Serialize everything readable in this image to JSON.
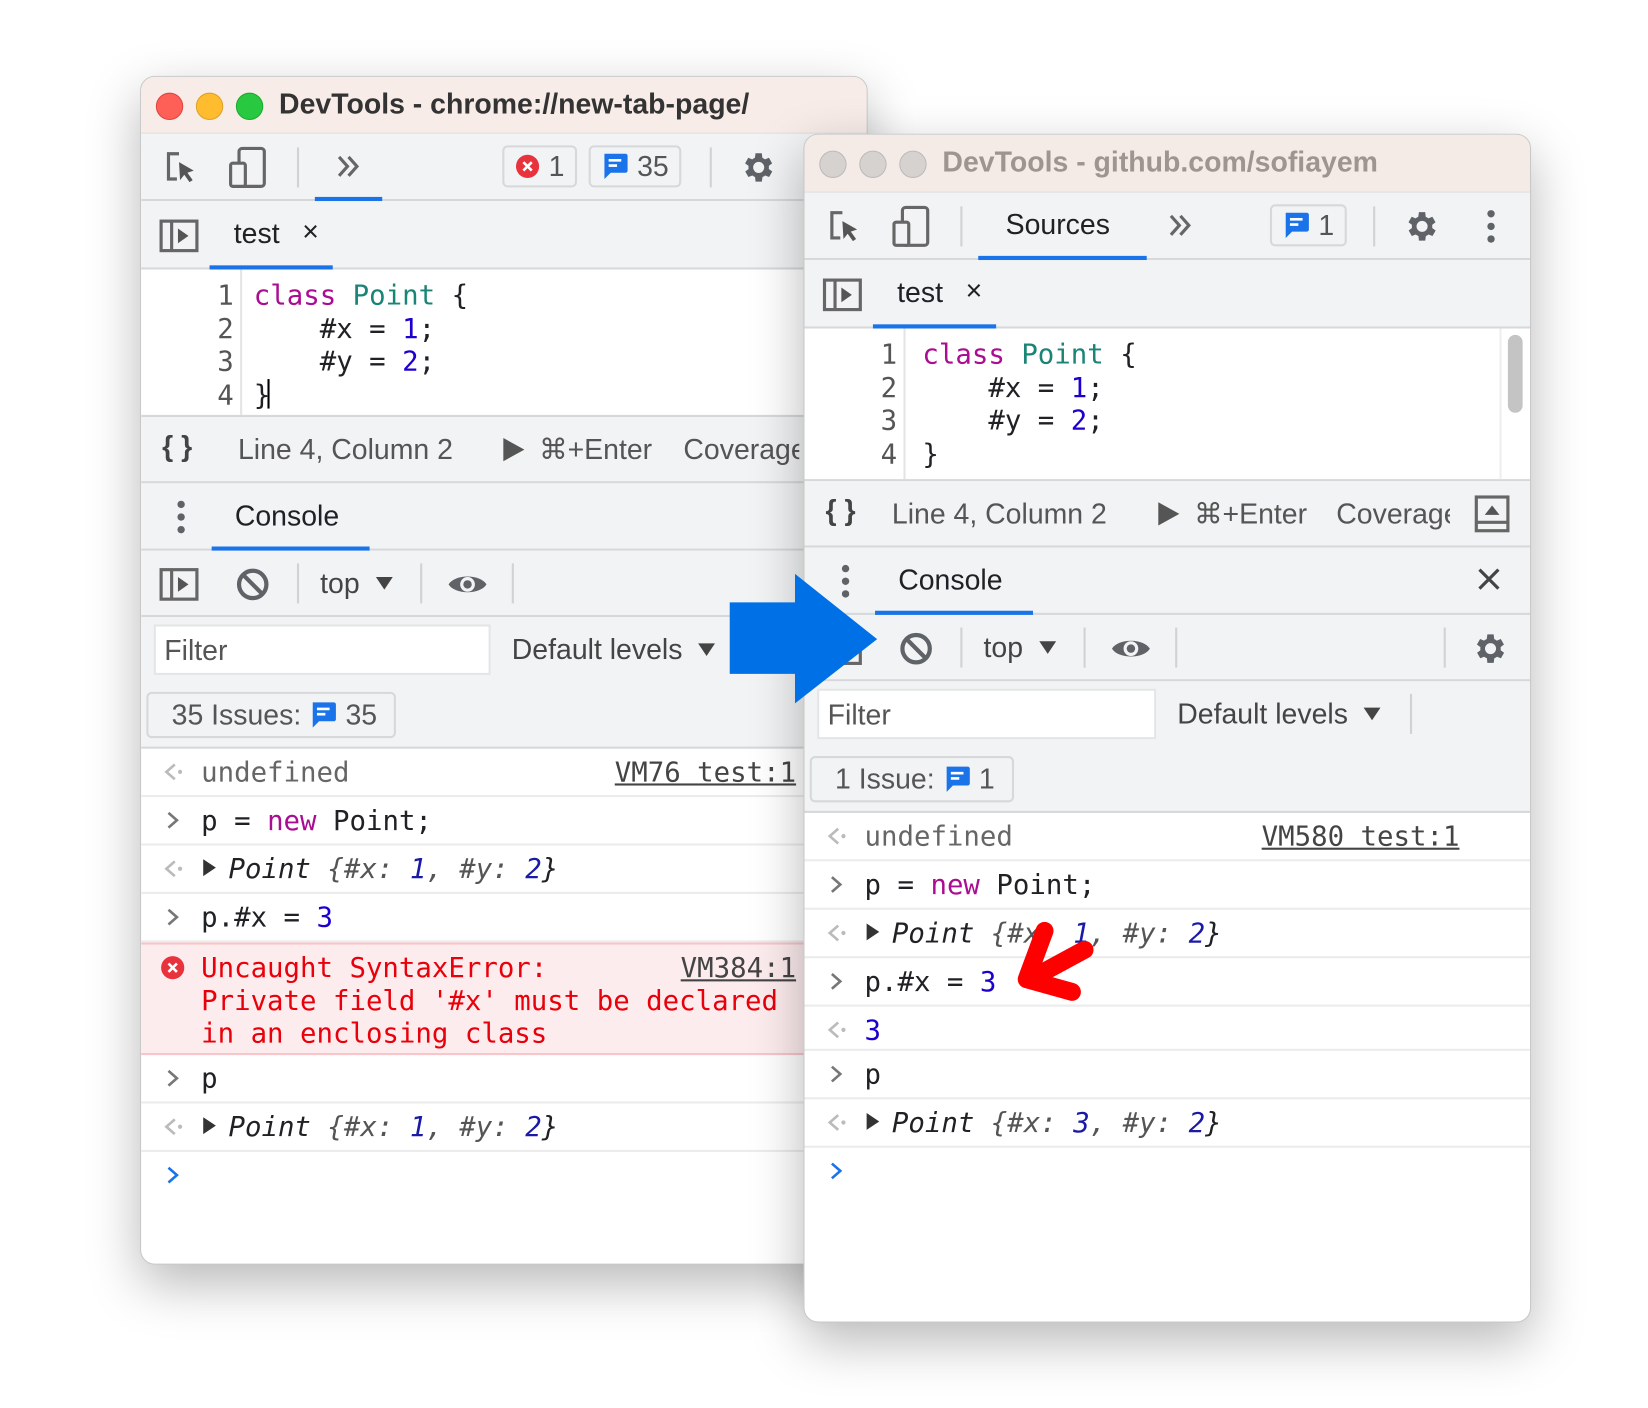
{
  "colors": {
    "accent": "#1a73e8",
    "error": "#e8000a",
    "annotation_blue": "#0070e6",
    "annotation_red": "#ff0000"
  },
  "left": {
    "title": "DevTools - chrome://new-tab-page/",
    "toolbar": {
      "more_tabs": "»",
      "error_count": "1",
      "issue_count": "35"
    },
    "editor_tab": {
      "label": "test",
      "close": "×"
    },
    "code": [
      {
        "n": "1",
        "tokens": [
          {
            "t": "class ",
            "c": "kw"
          },
          {
            "t": "Point ",
            "c": "cls"
          },
          {
            "t": "{",
            "c": "plain"
          }
        ]
      },
      {
        "n": "2",
        "tokens": [
          {
            "t": "    #x = ",
            "c": "plain"
          },
          {
            "t": "1",
            "c": "num"
          },
          {
            "t": ";",
            "c": "plain"
          }
        ]
      },
      {
        "n": "3",
        "tokens": [
          {
            "t": "    #y = ",
            "c": "plain"
          },
          {
            "t": "2",
            "c": "num"
          },
          {
            "t": ";",
            "c": "plain"
          }
        ]
      },
      {
        "n": "4",
        "tokens": [
          {
            "t": "}",
            "c": "plain"
          }
        ]
      }
    ],
    "status": {
      "format": "{ }",
      "position": "Line 4, Column 2",
      "run": "⌘+Enter",
      "coverage": "Coverage"
    },
    "drawer": {
      "tab": "Console"
    },
    "console_toolbar": {
      "context": "top"
    },
    "filter": {
      "placeholder": "Filter",
      "levels": "Default levels"
    },
    "issues": {
      "label": "35 Issues:",
      "count": "35"
    },
    "messages": [
      {
        "kind": "output",
        "tokens": [
          {
            "t": "undefined",
            "c": "gray"
          }
        ],
        "link": "VM76 test:1"
      },
      {
        "kind": "input",
        "tokens": [
          {
            "t": "p = ",
            "c": "plain"
          },
          {
            "t": "new",
            "c": "kw"
          },
          {
            "t": " Point;",
            "c": "plain"
          }
        ]
      },
      {
        "kind": "output",
        "expand": true,
        "tokens": [
          {
            "t": "Point ",
            "c": "obj"
          },
          {
            "t": "{#x: ",
            "c": "objkey"
          },
          {
            "t": "1",
            "c": "objnum"
          },
          {
            "t": ", #y: ",
            "c": "objkey"
          },
          {
            "t": "2",
            "c": "objnum"
          },
          {
            "t": "}",
            "c": "obj"
          }
        ]
      },
      {
        "kind": "input",
        "tokens": [
          {
            "t": "p.#x = ",
            "c": "plain"
          },
          {
            "t": "3",
            "c": "num"
          }
        ]
      },
      {
        "kind": "error",
        "tokens": [
          {
            "t": "Uncaught SyntaxError:\nPrivate field '#x' must be declared\nin an enclosing class",
            "c": "err"
          }
        ],
        "link": "VM384:1"
      },
      {
        "kind": "input",
        "tokens": [
          {
            "t": "p",
            "c": "plain"
          }
        ]
      },
      {
        "kind": "output",
        "expand": true,
        "tokens": [
          {
            "t": "Point ",
            "c": "obj"
          },
          {
            "t": "{#x: ",
            "c": "objkey"
          },
          {
            "t": "1",
            "c": "objnum"
          },
          {
            "t": ", #y: ",
            "c": "objkey"
          },
          {
            "t": "2",
            "c": "objnum"
          },
          {
            "t": "}",
            "c": "obj"
          }
        ]
      },
      {
        "kind": "prompt",
        "tokens": []
      }
    ]
  },
  "right": {
    "title": "DevTools - github.com/sofiayem",
    "toolbar": {
      "active_tab": "Sources",
      "more_tabs": "»",
      "issue_count": "1"
    },
    "editor_tab": {
      "label": "test",
      "close": "×"
    },
    "code": [
      {
        "n": "1",
        "tokens": [
          {
            "t": "class ",
            "c": "kw"
          },
          {
            "t": "Point ",
            "c": "cls"
          },
          {
            "t": "{",
            "c": "plain"
          }
        ]
      },
      {
        "n": "2",
        "tokens": [
          {
            "t": "    #x = ",
            "c": "plain"
          },
          {
            "t": "1",
            "c": "num"
          },
          {
            "t": ";",
            "c": "plain"
          }
        ]
      },
      {
        "n": "3",
        "tokens": [
          {
            "t": "    #y = ",
            "c": "plain"
          },
          {
            "t": "2",
            "c": "num"
          },
          {
            "t": ";",
            "c": "plain"
          }
        ]
      },
      {
        "n": "4",
        "tokens": [
          {
            "t": "}",
            "c": "plain"
          }
        ]
      }
    ],
    "status": {
      "format": "{ }",
      "position": "Line 4, Column 2",
      "run": "⌘+Enter",
      "coverage": "Coverage"
    },
    "drawer": {
      "tab": "Console",
      "close": "✕"
    },
    "console_toolbar": {
      "context": "top"
    },
    "filter": {
      "placeholder": "Filter",
      "levels": "Default levels"
    },
    "issues": {
      "label": "1 Issue:",
      "count": "1"
    },
    "messages": [
      {
        "kind": "output",
        "tokens": [
          {
            "t": "undefined",
            "c": "gray"
          }
        ],
        "link": "VM580 test:1"
      },
      {
        "kind": "input",
        "tokens": [
          {
            "t": "p = ",
            "c": "plain"
          },
          {
            "t": "new",
            "c": "kw"
          },
          {
            "t": " Point;",
            "c": "plain"
          }
        ]
      },
      {
        "kind": "output",
        "expand": true,
        "tokens": [
          {
            "t": "Point ",
            "c": "obj"
          },
          {
            "t": "{#x: ",
            "c": "objkey"
          },
          {
            "t": "1",
            "c": "objnum"
          },
          {
            "t": ", #y: ",
            "c": "objkey"
          },
          {
            "t": "2",
            "c": "objnum"
          },
          {
            "t": "}",
            "c": "obj"
          }
        ]
      },
      {
        "kind": "input",
        "tokens": [
          {
            "t": "p.#x = ",
            "c": "plain"
          },
          {
            "t": "3",
            "c": "num"
          }
        ]
      },
      {
        "kind": "output",
        "tokens": [
          {
            "t": "3",
            "c": "num"
          }
        ]
      },
      {
        "kind": "input",
        "tokens": [
          {
            "t": "p",
            "c": "plain"
          }
        ]
      },
      {
        "kind": "output",
        "expand": true,
        "tokens": [
          {
            "t": "Point ",
            "c": "obj"
          },
          {
            "t": "{#x: ",
            "c": "objkey"
          },
          {
            "t": "3",
            "c": "objnum"
          },
          {
            "t": ", #y: ",
            "c": "objkey"
          },
          {
            "t": "2",
            "c": "objnum"
          },
          {
            "t": "}",
            "c": "obj"
          }
        ]
      },
      {
        "kind": "prompt",
        "tokens": []
      }
    ]
  }
}
